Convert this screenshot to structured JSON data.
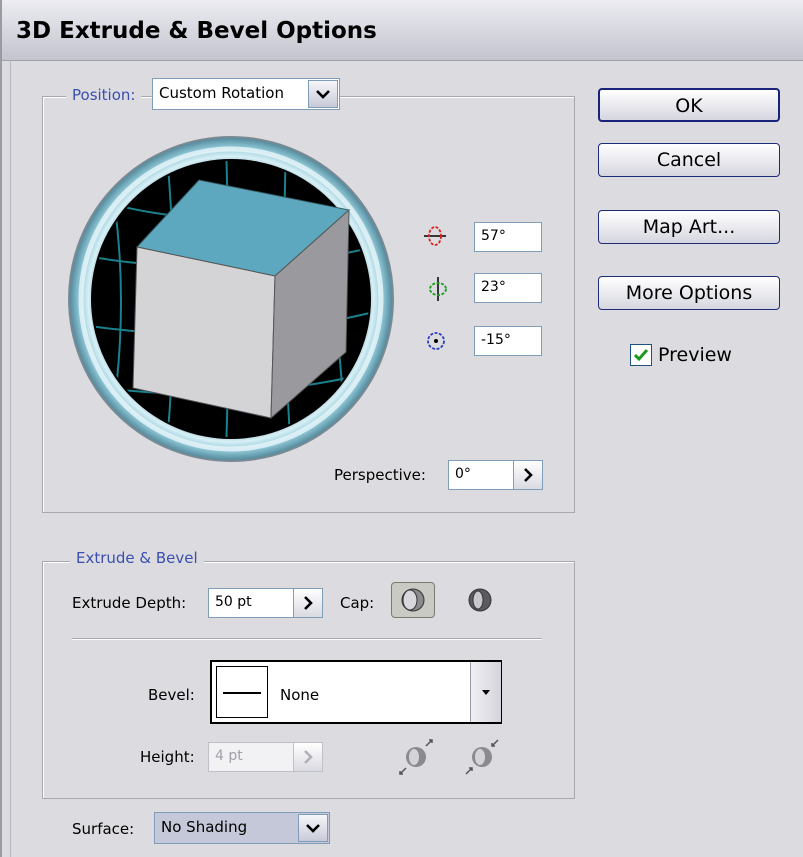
{
  "dialog": {
    "title": "3D Extrude & Bevel Options"
  },
  "buttons": {
    "ok": "OK",
    "cancel": "Cancel",
    "map_art": "Map Art...",
    "more_options": "More Options"
  },
  "preview": {
    "label": "Preview",
    "checked": true
  },
  "position": {
    "legend": "Position:",
    "dropdown_value": "Custom Rotation",
    "rotation_x": "57°",
    "rotation_y": "23°",
    "rotation_z": "-15°",
    "perspective_label": "Perspective:",
    "perspective_value": "0°"
  },
  "extrude": {
    "legend": "Extrude & Bevel",
    "depth_label": "Extrude Depth:",
    "depth_value": "50 pt",
    "cap_label": "Cap:",
    "bevel_label": "Bevel:",
    "bevel_value": "None",
    "height_label": "Height:",
    "height_value": "4 pt"
  },
  "surface": {
    "label": "Surface:",
    "value": "No Shading"
  },
  "colors": {
    "accent": "#3a4fb0",
    "button_border": "#1e2c78",
    "cube_top": "#5ea8bf",
    "check": "#1a9a1a"
  }
}
